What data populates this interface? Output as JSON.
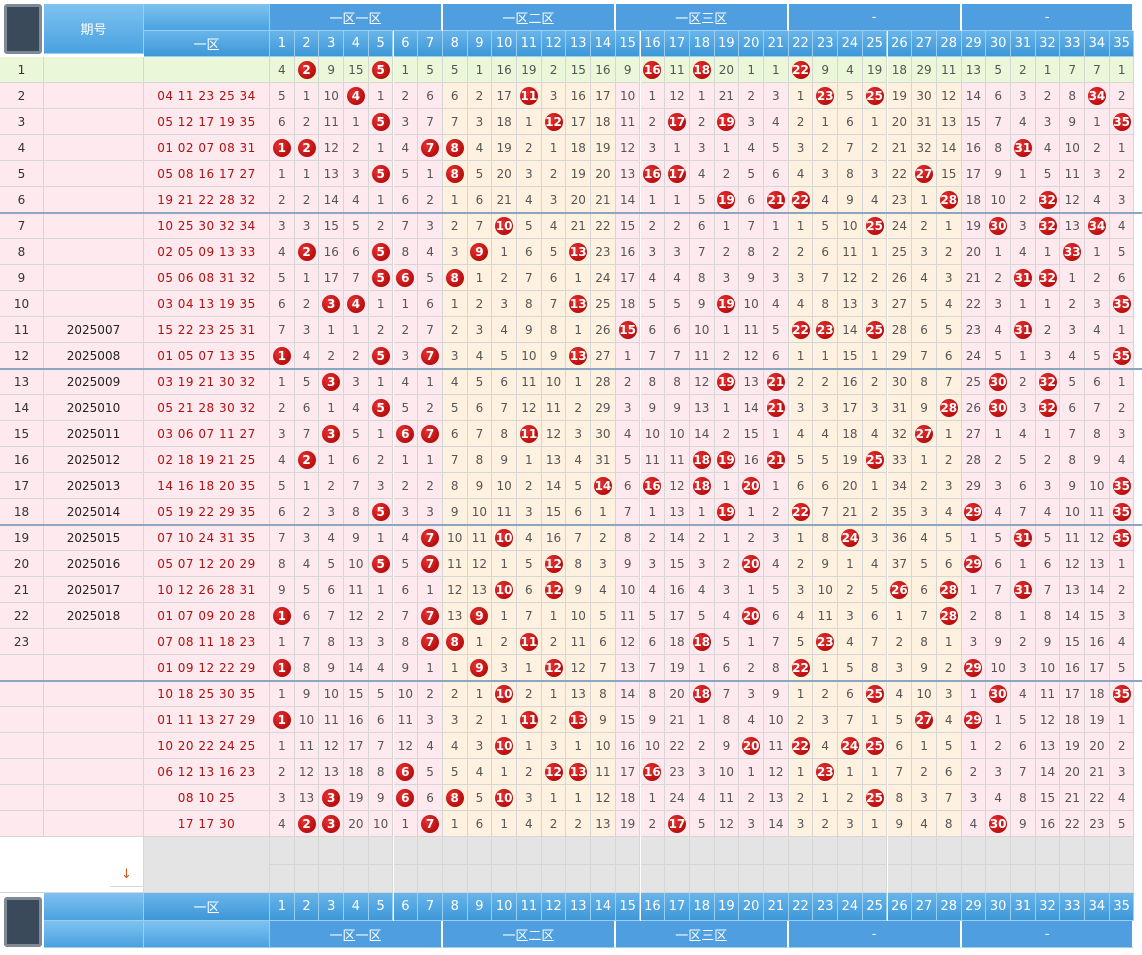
{
  "header": {
    "period_label": "期号",
    "zone_label": "一区",
    "zones": [
      "一区一区",
      "一区二区",
      "一区三区",
      "-",
      "-"
    ],
    "numbers": [
      "1",
      "2",
      "3",
      "4",
      "5",
      "6",
      "7",
      "8",
      "9",
      "10",
      "11",
      "12",
      "13",
      "14",
      "15",
      "16",
      "17",
      "18",
      "19",
      "20",
      "21",
      "22",
      "23",
      "24",
      "25",
      "26",
      "27",
      "28",
      "29",
      "30",
      "31",
      "32",
      "33",
      "34",
      "35"
    ]
  },
  "footer": {
    "zone_label": "一区",
    "zones": [
      "一区一区",
      "一区二区",
      "一区三区",
      "-",
      "-"
    ],
    "sort_icon": "↓"
  },
  "rows": [
    {
      "n": "1",
      "p": "",
      "d": "",
      "v": [
        "4",
        "2",
        "9",
        "15",
        "5",
        "1",
        "5",
        "5",
        "1",
        "16",
        "19",
        "2",
        "15",
        "16",
        "9",
        "16",
        "11",
        "18",
        "20",
        "1",
        "1",
        "22",
        "9",
        "4",
        "19",
        "18",
        "29",
        "11",
        "13",
        "5",
        "2",
        "1",
        "7",
        "7",
        "1"
      ]
    },
    {
      "n": "2",
      "p": "",
      "d": "04 11 23 25 34",
      "v": [
        "5",
        "1",
        "10",
        "4",
        "1",
        "2",
        "6",
        "6",
        "2",
        "17",
        "11",
        "3",
        "16",
        "17",
        "10",
        "1",
        "12",
        "1",
        "21",
        "2",
        "3",
        "1",
        "23",
        "5",
        "25",
        "19",
        "30",
        "12",
        "14",
        "6",
        "3",
        "2",
        "8",
        "34",
        "2"
      ]
    },
    {
      "n": "3",
      "p": "",
      "d": "05 12 17 19 35",
      "v": [
        "6",
        "2",
        "11",
        "1",
        "5",
        "3",
        "7",
        "7",
        "3",
        "18",
        "1",
        "12",
        "17",
        "18",
        "11",
        "2",
        "17",
        "2",
        "19",
        "3",
        "4",
        "2",
        "1",
        "6",
        "1",
        "20",
        "31",
        "13",
        "15",
        "7",
        "4",
        "3",
        "9",
        "1",
        "35"
      ]
    },
    {
      "n": "4",
      "p": "",
      "d": "01 02 07 08 31",
      "v": [
        "1",
        "2",
        "12",
        "2",
        "1",
        "4",
        "7",
        "8",
        "4",
        "19",
        "2",
        "1",
        "18",
        "19",
        "12",
        "3",
        "1",
        "3",
        "1",
        "4",
        "5",
        "3",
        "2",
        "7",
        "2",
        "21",
        "32",
        "14",
        "16",
        "8",
        "31",
        "4",
        "10",
        "2",
        "1"
      ]
    },
    {
      "n": "5",
      "p": "",
      "d": "05 08 16 17 27",
      "v": [
        "1",
        "1",
        "13",
        "3",
        "5",
        "5",
        "1",
        "8",
        "5",
        "20",
        "3",
        "2",
        "19",
        "20",
        "13",
        "16",
        "17",
        "4",
        "2",
        "5",
        "6",
        "4",
        "3",
        "8",
        "3",
        "22",
        "27",
        "15",
        "17",
        "9",
        "1",
        "5",
        "11",
        "3",
        "2"
      ]
    },
    {
      "n": "6",
      "p": "",
      "d": "19 21 22 28 32",
      "v": [
        "2",
        "2",
        "14",
        "4",
        "1",
        "6",
        "2",
        "1",
        "6",
        "21",
        "4",
        "3",
        "20",
        "21",
        "14",
        "1",
        "1",
        "5",
        "19",
        "6",
        "21",
        "22",
        "4",
        "9",
        "4",
        "23",
        "1",
        "28",
        "18",
        "10",
        "2",
        "32",
        "12",
        "4",
        "3"
      ]
    },
    {
      "n": "7",
      "p": "",
      "d": "10 25 30 32 34",
      "v": [
        "3",
        "3",
        "15",
        "5",
        "2",
        "7",
        "3",
        "2",
        "7",
        "10",
        "5",
        "4",
        "21",
        "22",
        "15",
        "2",
        "2",
        "6",
        "1",
        "7",
        "1",
        "1",
        "5",
        "10",
        "25",
        "24",
        "2",
        "1",
        "19",
        "30",
        "3",
        "32",
        "13",
        "34",
        "4"
      ]
    },
    {
      "n": "8",
      "p": "",
      "d": "02 05 09 13 33",
      "v": [
        "4",
        "2",
        "16",
        "6",
        "5",
        "8",
        "4",
        "3",
        "9",
        "1",
        "6",
        "5",
        "13",
        "23",
        "16",
        "3",
        "3",
        "7",
        "2",
        "8",
        "2",
        "2",
        "6",
        "11",
        "1",
        "25",
        "3",
        "2",
        "20",
        "1",
        "4",
        "1",
        "33",
        "1",
        "5"
      ]
    },
    {
      "n": "9",
      "p": "",
      "d": "05 06 08 31 32",
      "v": [
        "5",
        "1",
        "17",
        "7",
        "5",
        "6",
        "5",
        "8",
        "1",
        "2",
        "7",
        "6",
        "1",
        "24",
        "17",
        "4",
        "4",
        "8",
        "3",
        "9",
        "3",
        "3",
        "7",
        "12",
        "2",
        "26",
        "4",
        "3",
        "21",
        "2",
        "31",
        "32",
        "1",
        "2",
        "6"
      ]
    },
    {
      "n": "10",
      "p": "",
      "d": "03 04 13 19 35",
      "v": [
        "6",
        "2",
        "3",
        "4",
        "1",
        "1",
        "6",
        "1",
        "2",
        "3",
        "8",
        "7",
        "13",
        "25",
        "18",
        "5",
        "5",
        "9",
        "19",
        "10",
        "4",
        "4",
        "8",
        "13",
        "3",
        "27",
        "5",
        "4",
        "22",
        "3",
        "1",
        "1",
        "2",
        "3",
        "35"
      ]
    },
    {
      "n": "11",
      "p": "2025007",
      "d": "15 22 23 25 31",
      "v": [
        "7",
        "3",
        "1",
        "1",
        "2",
        "2",
        "7",
        "2",
        "3",
        "4",
        "9",
        "8",
        "1",
        "26",
        "15",
        "6",
        "6",
        "10",
        "1",
        "11",
        "5",
        "22",
        "23",
        "14",
        "25",
        "28",
        "6",
        "5",
        "23",
        "4",
        "31",
        "2",
        "3",
        "4",
        "1"
      ]
    },
    {
      "n": "12",
      "p": "2025008",
      "d": "01 05 07 13 35",
      "v": [
        "1",
        "4",
        "2",
        "2",
        "5",
        "3",
        "7",
        "3",
        "4",
        "5",
        "10",
        "9",
        "13",
        "27",
        "1",
        "7",
        "7",
        "11",
        "2",
        "12",
        "6",
        "1",
        "1",
        "15",
        "1",
        "29",
        "7",
        "6",
        "24",
        "5",
        "1",
        "3",
        "4",
        "5",
        "35"
      ]
    },
    {
      "n": "13",
      "p": "2025009",
      "d": "03 19 21 30 32",
      "v": [
        "1",
        "5",
        "3",
        "3",
        "1",
        "4",
        "1",
        "4",
        "5",
        "6",
        "11",
        "10",
        "1",
        "28",
        "2",
        "8",
        "8",
        "12",
        "19",
        "13",
        "21",
        "2",
        "2",
        "16",
        "2",
        "30",
        "8",
        "7",
        "25",
        "30",
        "2",
        "32",
        "5",
        "6",
        "1"
      ]
    },
    {
      "n": "14",
      "p": "2025010",
      "d": "05 21 28 30 32",
      "v": [
        "2",
        "6",
        "1",
        "4",
        "5",
        "5",
        "2",
        "5",
        "6",
        "7",
        "12",
        "11",
        "2",
        "29",
        "3",
        "9",
        "9",
        "13",
        "1",
        "14",
        "21",
        "3",
        "3",
        "17",
        "3",
        "31",
        "9",
        "28",
        "26",
        "30",
        "3",
        "32",
        "6",
        "7",
        "2"
      ]
    },
    {
      "n": "15",
      "p": "2025011",
      "d": "03 06 07 11 27",
      "v": [
        "3",
        "7",
        "3",
        "5",
        "1",
        "6",
        "7",
        "6",
        "7",
        "8",
        "11",
        "12",
        "3",
        "30",
        "4",
        "10",
        "10",
        "14",
        "2",
        "15",
        "1",
        "4",
        "4",
        "18",
        "4",
        "32",
        "27",
        "1",
        "27",
        "1",
        "4",
        "1",
        "7",
        "8",
        "3"
      ]
    },
    {
      "n": "16",
      "p": "2025012",
      "d": "02 18 19 21 25",
      "v": [
        "4",
        "2",
        "1",
        "6",
        "2",
        "1",
        "1",
        "7",
        "8",
        "9",
        "1",
        "13",
        "4",
        "31",
        "5",
        "11",
        "11",
        "18",
        "19",
        "16",
        "21",
        "5",
        "5",
        "19",
        "25",
        "33",
        "1",
        "2",
        "28",
        "2",
        "5",
        "2",
        "8",
        "9",
        "4"
      ]
    },
    {
      "n": "17",
      "p": "2025013",
      "d": "14 16 18 20 35",
      "v": [
        "5",
        "1",
        "2",
        "7",
        "3",
        "2",
        "2",
        "8",
        "9",
        "10",
        "2",
        "14",
        "5",
        "14",
        "6",
        "16",
        "12",
        "18",
        "1",
        "20",
        "1",
        "6",
        "6",
        "20",
        "1",
        "34",
        "2",
        "3",
        "29",
        "3",
        "6",
        "3",
        "9",
        "10",
        "35"
      ]
    },
    {
      "n": "18",
      "p": "2025014",
      "d": "05 19 22 29 35",
      "v": [
        "6",
        "2",
        "3",
        "8",
        "5",
        "3",
        "3",
        "9",
        "10",
        "11",
        "3",
        "15",
        "6",
        "1",
        "7",
        "1",
        "13",
        "1",
        "19",
        "1",
        "2",
        "22",
        "7",
        "21",
        "2",
        "35",
        "3",
        "4",
        "29",
        "4",
        "7",
        "4",
        "10",
        "11",
        "35"
      ]
    },
    {
      "n": "19",
      "p": "2025015",
      "d": "07 10 24 31 35",
      "v": [
        "7",
        "3",
        "4",
        "9",
        "1",
        "4",
        "7",
        "10",
        "11",
        "10",
        "4",
        "16",
        "7",
        "2",
        "8",
        "2",
        "14",
        "2",
        "1",
        "2",
        "3",
        "1",
        "8",
        "24",
        "3",
        "36",
        "4",
        "5",
        "1",
        "5",
        "31",
        "5",
        "11",
        "12",
        "35"
      ]
    },
    {
      "n": "20",
      "p": "2025016",
      "d": "05 07 12 20 29",
      "v": [
        "8",
        "4",
        "5",
        "10",
        "5",
        "5",
        "7",
        "11",
        "12",
        "1",
        "5",
        "12",
        "8",
        "3",
        "9",
        "3",
        "15",
        "3",
        "2",
        "20",
        "4",
        "2",
        "9",
        "1",
        "4",
        "37",
        "5",
        "6",
        "29",
        "6",
        "1",
        "6",
        "12",
        "13",
        "1"
      ]
    },
    {
      "n": "21",
      "p": "2025017",
      "d": "10 12 26 28 31",
      "v": [
        "9",
        "5",
        "6",
        "11",
        "1",
        "6",
        "1",
        "12",
        "13",
        "10",
        "6",
        "12",
        "9",
        "4",
        "10",
        "4",
        "16",
        "4",
        "3",
        "1",
        "5",
        "3",
        "10",
        "2",
        "5",
        "26",
        "6",
        "28",
        "1",
        "7",
        "31",
        "7",
        "13",
        "14",
        "2"
      ]
    },
    {
      "n": "22",
      "p": "2025018",
      "d": "01 07 09 20 28",
      "v": [
        "1",
        "6",
        "7",
        "12",
        "2",
        "7",
        "7",
        "13",
        "9",
        "1",
        "7",
        "1",
        "10",
        "5",
        "11",
        "5",
        "17",
        "5",
        "4",
        "20",
        "6",
        "4",
        "11",
        "3",
        "6",
        "1",
        "7",
        "28",
        "2",
        "8",
        "1",
        "8",
        "14",
        "15",
        "3"
      ]
    },
    {
      "n": "23",
      "p": "",
      "d": "07 08 11 18 23",
      "v": [
        "1",
        "7",
        "8",
        "13",
        "3",
        "8",
        "7",
        "8",
        "1",
        "2",
        "11",
        "2",
        "11",
        "6",
        "12",
        "6",
        "18",
        "18",
        "5",
        "1",
        "7",
        "5",
        "23",
        "4",
        "7",
        "2",
        "8",
        "1",
        "3",
        "9",
        "2",
        "9",
        "15",
        "16",
        "4"
      ]
    },
    {
      "n": "",
      "p": "",
      "d": "01 09 12 22 29",
      "v": [
        "1",
        "8",
        "9",
        "14",
        "4",
        "9",
        "1",
        "1",
        "9",
        "3",
        "1",
        "12",
        "12",
        "7",
        "13",
        "7",
        "19",
        "1",
        "6",
        "2",
        "8",
        "22",
        "1",
        "5",
        "8",
        "3",
        "9",
        "2",
        "29",
        "10",
        "3",
        "10",
        "16",
        "17",
        "5"
      ]
    },
    {
      "n": "",
      "p": "",
      "d": "10 18 25 30 35",
      "v": [
        "1",
        "9",
        "10",
        "15",
        "5",
        "10",
        "2",
        "2",
        "1",
        "10",
        "2",
        "1",
        "13",
        "8",
        "14",
        "8",
        "20",
        "18",
        "7",
        "3",
        "9",
        "1",
        "2",
        "6",
        "25",
        "4",
        "10",
        "3",
        "1",
        "30",
        "4",
        "11",
        "17",
        "18",
        "35"
      ]
    },
    {
      "n": "",
      "p": "",
      "d": "01 11 13 27 29",
      "v": [
        "1",
        "10",
        "11",
        "16",
        "6",
        "11",
        "3",
        "3",
        "2",
        "1",
        "11",
        "2",
        "13",
        "9",
        "15",
        "9",
        "21",
        "1",
        "8",
        "4",
        "10",
        "2",
        "3",
        "7",
        "1",
        "5",
        "27",
        "4",
        "29",
        "1",
        "5",
        "12",
        "18",
        "19",
        "1"
      ]
    },
    {
      "n": "",
      "p": "",
      "d": "10 20 22 24 25",
      "v": [
        "1",
        "11",
        "12",
        "17",
        "7",
        "12",
        "4",
        "4",
        "3",
        "10",
        "1",
        "3",
        "1",
        "10",
        "16",
        "10",
        "22",
        "2",
        "9",
        "20",
        "11",
        "22",
        "4",
        "24",
        "25",
        "6",
        "1",
        "5",
        "1",
        "2",
        "6",
        "13",
        "19",
        "20",
        "2"
      ]
    },
    {
      "n": "",
      "p": "",
      "d": "06 12 13 16 23",
      "v": [
        "2",
        "12",
        "13",
        "18",
        "8",
        "6",
        "5",
        "5",
        "4",
        "1",
        "2",
        "12",
        "13",
        "11",
        "17",
        "16",
        "23",
        "3",
        "10",
        "1",
        "12",
        "1",
        "23",
        "1",
        "1",
        "7",
        "2",
        "6",
        "2",
        "3",
        "7",
        "14",
        "20",
        "21",
        "3"
      ]
    },
    {
      "n": "",
      "p": "",
      "d": "08 10 25",
      "v": [
        "3",
        "13",
        "3",
        "19",
        "9",
        "6",
        "6",
        "8",
        "5",
        "10",
        "3",
        "1",
        "1",
        "12",
        "18",
        "1",
        "24",
        "4",
        "11",
        "2",
        "13",
        "2",
        "1",
        "2",
        "25",
        "8",
        "3",
        "7",
        "3",
        "4",
        "8",
        "15",
        "21",
        "22",
        "4"
      ]
    },
    {
      "n": "",
      "p": "",
      "d": "17 17 30",
      "v": [
        "4",
        "2",
        "3",
        "20",
        "10",
        "1",
        "7",
        "1",
        "6",
        "1",
        "4",
        "2",
        "2",
        "13",
        "19",
        "2",
        "17",
        "5",
        "12",
        "3",
        "14",
        "3",
        "2",
        "3",
        "1",
        "9",
        "4",
        "8",
        "4",
        "30",
        "9",
        "16",
        "22",
        "23",
        "5"
      ]
    }
  ],
  "hits": [
    [
      2,
      5,
      16,
      18,
      22
    ],
    [
      4,
      11,
      23,
      25,
      34
    ],
    [
      5,
      12,
      17,
      19,
      35
    ],
    [
      1,
      2,
      7,
      8,
      31
    ],
    [
      5,
      8,
      16,
      17,
      27
    ],
    [
      19,
      21,
      22,
      28,
      32
    ],
    [
      10,
      25,
      30,
      32,
      34
    ],
    [
      2,
      5,
      9,
      13,
      33
    ],
    [
      5,
      6,
      8,
      31,
      32
    ],
    [
      3,
      4,
      13,
      19,
      35
    ],
    [
      15,
      22,
      23,
      25,
      31
    ],
    [
      1,
      5,
      7,
      13,
      35
    ],
    [
      3,
      19,
      21,
      30,
      32
    ],
    [
      5,
      21,
      28,
      30,
      32
    ],
    [
      3,
      6,
      7,
      11,
      27
    ],
    [
      2,
      18,
      19,
      21,
      25
    ],
    [
      14,
      16,
      18,
      20,
      35
    ],
    [
      5,
      19,
      22,
      29,
      35
    ],
    [
      7,
      10,
      24,
      31,
      35
    ],
    [
      5,
      7,
      12,
      20,
      29
    ],
    [
      10,
      12,
      26,
      28,
      31
    ],
    [
      1,
      7,
      9,
      20,
      28
    ],
    [
      7,
      8,
      11,
      18,
      23
    ],
    [
      1,
      9,
      12,
      22,
      29
    ],
    [
      10,
      18,
      25,
      30,
      35
    ],
    [
      1,
      11,
      13,
      27,
      29
    ],
    [
      10,
      20,
      22,
      24,
      25
    ],
    [
      6,
      12,
      13,
      16,
      23
    ],
    [
      3,
      6,
      8,
      10,
      25
    ],
    [
      2,
      3,
      7,
      17,
      30
    ]
  ],
  "colors": {
    "ball": "#c00000",
    "header": "#4aa2e0",
    "highlight": "#eaf7d8"
  }
}
